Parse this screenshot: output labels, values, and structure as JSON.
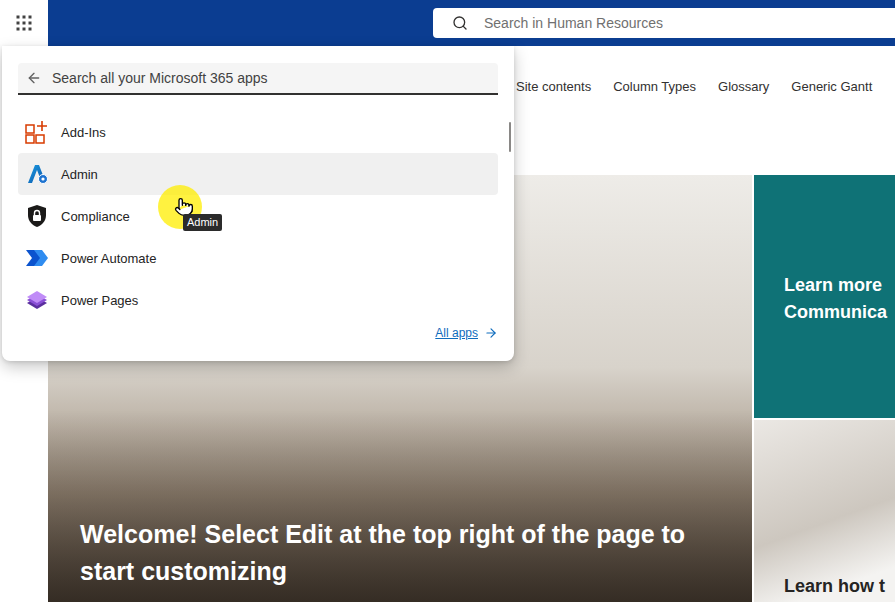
{
  "top_bar": {
    "search_placeholder": "Search in Human Resources"
  },
  "nav": [
    {
      "label": "Site contents"
    },
    {
      "label": "Column Types"
    },
    {
      "label": "Glossary"
    },
    {
      "label": "Generic Gantt"
    }
  ],
  "app_panel": {
    "search_placeholder": "Search all your Microsoft 365 apps",
    "apps": [
      {
        "name": "Add-Ins",
        "hovered": false
      },
      {
        "name": "Admin",
        "hovered": true
      },
      {
        "name": "Compliance",
        "hovered": false
      },
      {
        "name": "Power Automate",
        "hovered": false
      },
      {
        "name": "Power Pages",
        "hovered": false
      }
    ],
    "all_apps_link": "All apps"
  },
  "tooltip": {
    "text": "Admin"
  },
  "hero": {
    "title": "Welcome! Select Edit at the top right of the page to start customizing"
  },
  "tiles": [
    {
      "lines": [
        "Learn more",
        "Communica"
      ],
      "kind": "teal"
    },
    {
      "lines": [
        "Learn how t"
      ],
      "kind": "photo"
    }
  ]
}
